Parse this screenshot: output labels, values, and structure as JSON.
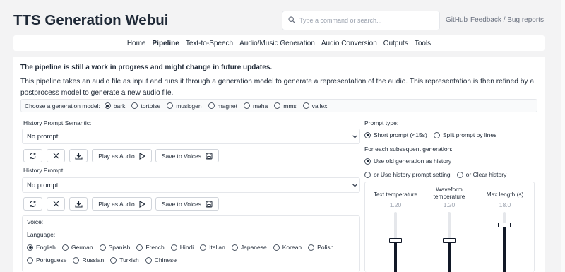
{
  "header": {
    "title": "TTS Generation Webui",
    "search_placeholder": "Type a command or search...",
    "links": [
      "GitHub",
      "Feedback / Bug reports"
    ]
  },
  "nav": {
    "tabs": [
      "Home",
      "Pipeline",
      "Text-to-Speech",
      "Audio/Music Generation",
      "Audio Conversion",
      "Outputs",
      "Tools"
    ],
    "active": "Pipeline"
  },
  "main": {
    "notice": "The pipeline is still a work in progress and might change in future updates.",
    "description": "This pipeline takes an audio file as input and runs it through a generation model to generate a representation of the audio. This representation is then refined by a postprocess model to generate a new audio file.",
    "model_label": "Choose a generation model:",
    "models": [
      "bark",
      "tortoise",
      "musicgen",
      "magnet",
      "maha",
      "mms",
      "vallex"
    ],
    "model_selected": "bark"
  },
  "left": {
    "semantic_label": "History Prompt Semantic:",
    "semantic_value": "No prompt",
    "prompt_label": "History Prompt:",
    "prompt_value": "No prompt",
    "play_label": "Play as Audio",
    "save_label": "Save to Voices",
    "voice_label": "Voice:",
    "language_label": "Language:",
    "languages": [
      "English",
      "German",
      "Spanish",
      "French",
      "Hindi",
      "Italian",
      "Japanese",
      "Korean",
      "Polish",
      "Portuguese",
      "Russian",
      "Turkish",
      "Chinese"
    ],
    "language_selected": "English"
  },
  "right": {
    "prompt_type_label": "Prompt type:",
    "prompt_types": [
      "Short prompt (<15s)",
      "Split prompt by lines"
    ],
    "prompt_type_selected": "Short prompt (<15s)",
    "subsequent_label": "For each subsequent generation:",
    "subsequent_options": [
      "Use old generation as history",
      "or Use history prompt setting",
      "or Clear history"
    ],
    "subsequent_selected": "Use old generation as history",
    "sliders": [
      {
        "label_1": "Text temperature",
        "label_2": "",
        "value": "1.20",
        "level": 0.6
      },
      {
        "label_1": "Waveform",
        "label_2": "temperature",
        "value": "1.20",
        "level": 0.6
      },
      {
        "label_1": "Max length (s)",
        "label_2": "",
        "value": "18.0",
        "level": 0.9
      }
    ]
  },
  "icons": [
    "search-icon",
    "refresh-icon",
    "close-icon",
    "download-icon",
    "play-icon",
    "save-icon",
    "chevron-down-icon"
  ]
}
